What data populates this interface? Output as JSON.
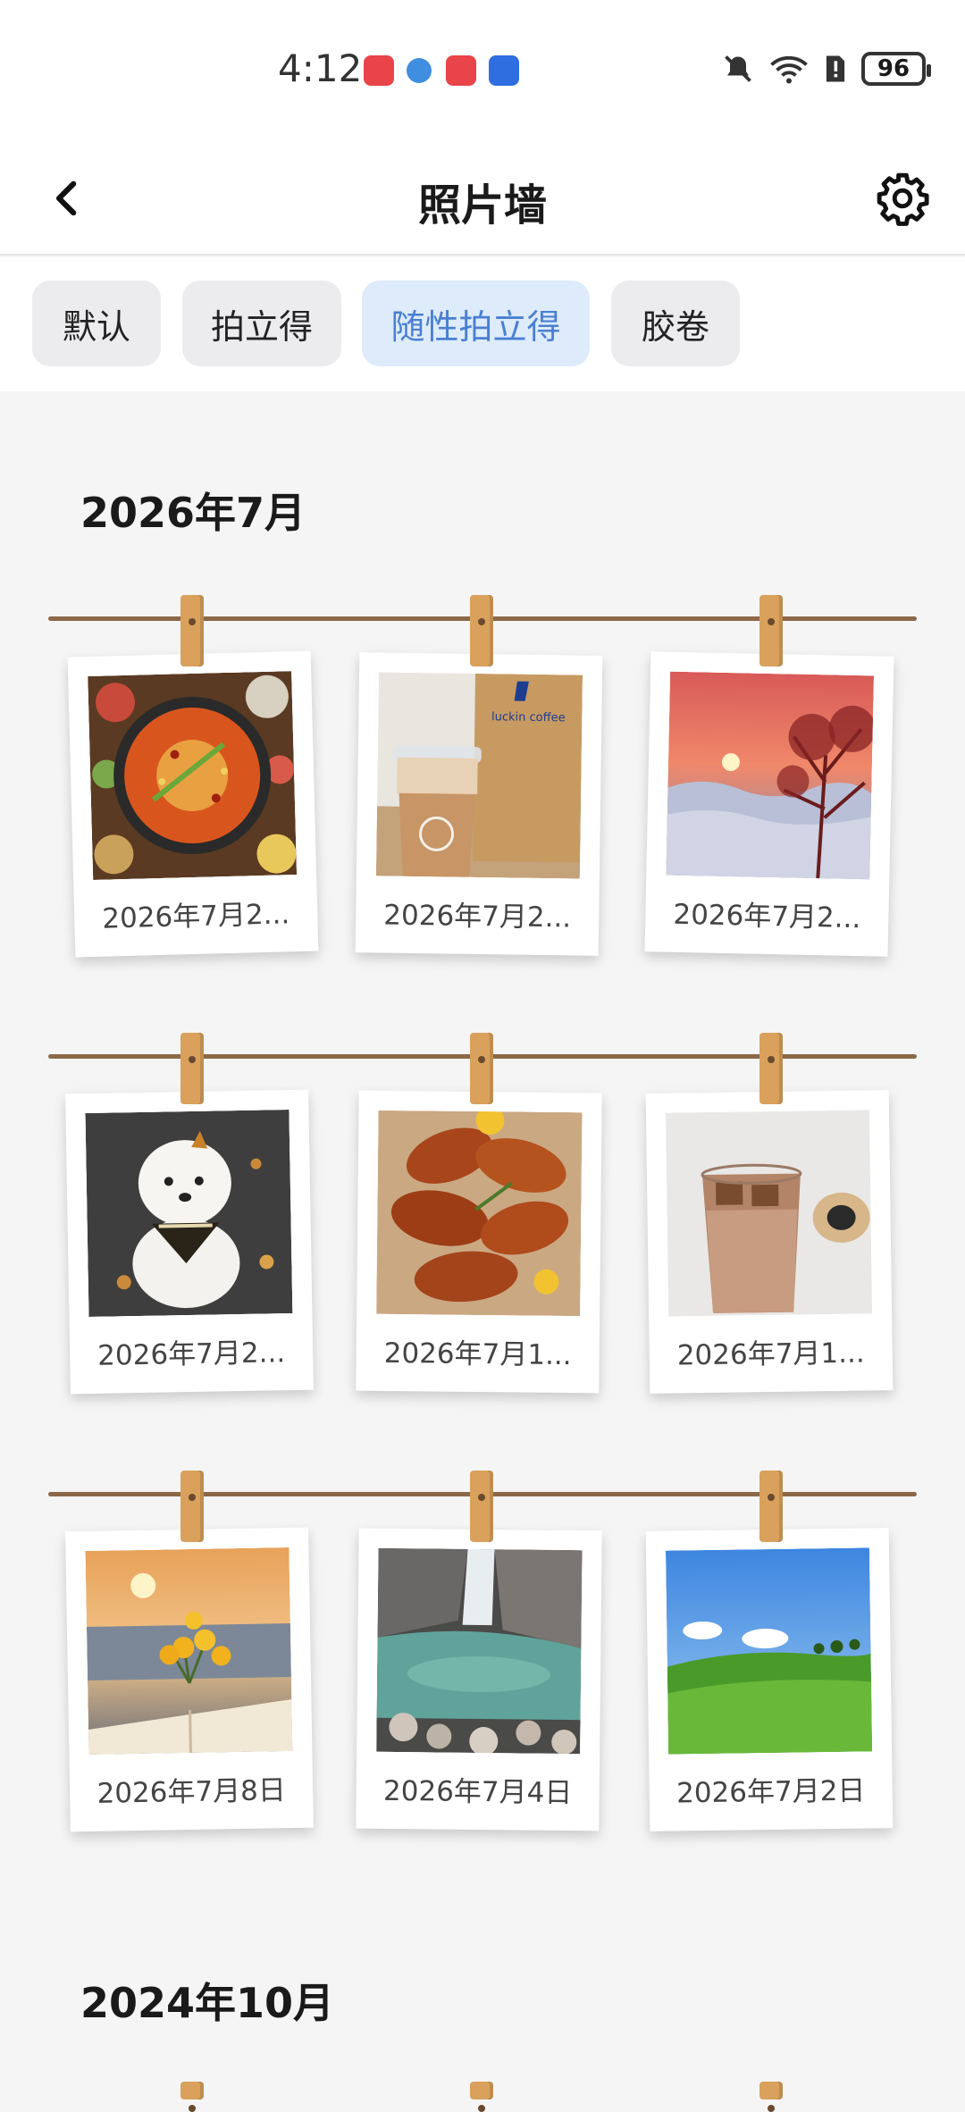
{
  "status_bar": {
    "time": "4:12",
    "battery": "96",
    "icons": [
      "huawei-store-icon",
      "browser-icon",
      "books-icon",
      "tips-icon",
      "mute-icon",
      "wifi-icon",
      "sim-alert-icon",
      "battery-icon"
    ]
  },
  "header": {
    "title": "照片墙",
    "back_icon": "chevron-left-icon",
    "settings_icon": "gear-icon"
  },
  "tabs": [
    {
      "label": "默认",
      "active": false
    },
    {
      "label": "拍立得",
      "active": false
    },
    {
      "label": "随性拍立得",
      "active": true
    },
    {
      "label": "胶卷",
      "active": false
    }
  ],
  "accent_color": "#4a7fd2",
  "sections": [
    {
      "month": "2026年7月",
      "photos": [
        {
          "caption": "2026年7月2...",
          "subject": "hotpot"
        },
        {
          "caption": "2026年7月2...",
          "subject": "luckin coffee"
        },
        {
          "caption": "2026年7月2...",
          "subject": "sunset sea of clouds"
        },
        {
          "caption": "2026年7月2...",
          "subject": "white puppy"
        },
        {
          "caption": "2026年7月1...",
          "subject": "grilled chicken wings"
        },
        {
          "caption": "2026年7月1...",
          "subject": "iced coffee"
        },
        {
          "caption": "2026年7月8日",
          "subject": "sunset flowers and book"
        },
        {
          "caption": "2026年7月4日",
          "subject": "waterfall stream"
        },
        {
          "caption": "2026年7月2日",
          "subject": "green meadow"
        }
      ]
    },
    {
      "month": "2024年10月",
      "photos": []
    }
  ],
  "photo_text": {
    "luckin_logo": "luckin coffee"
  }
}
